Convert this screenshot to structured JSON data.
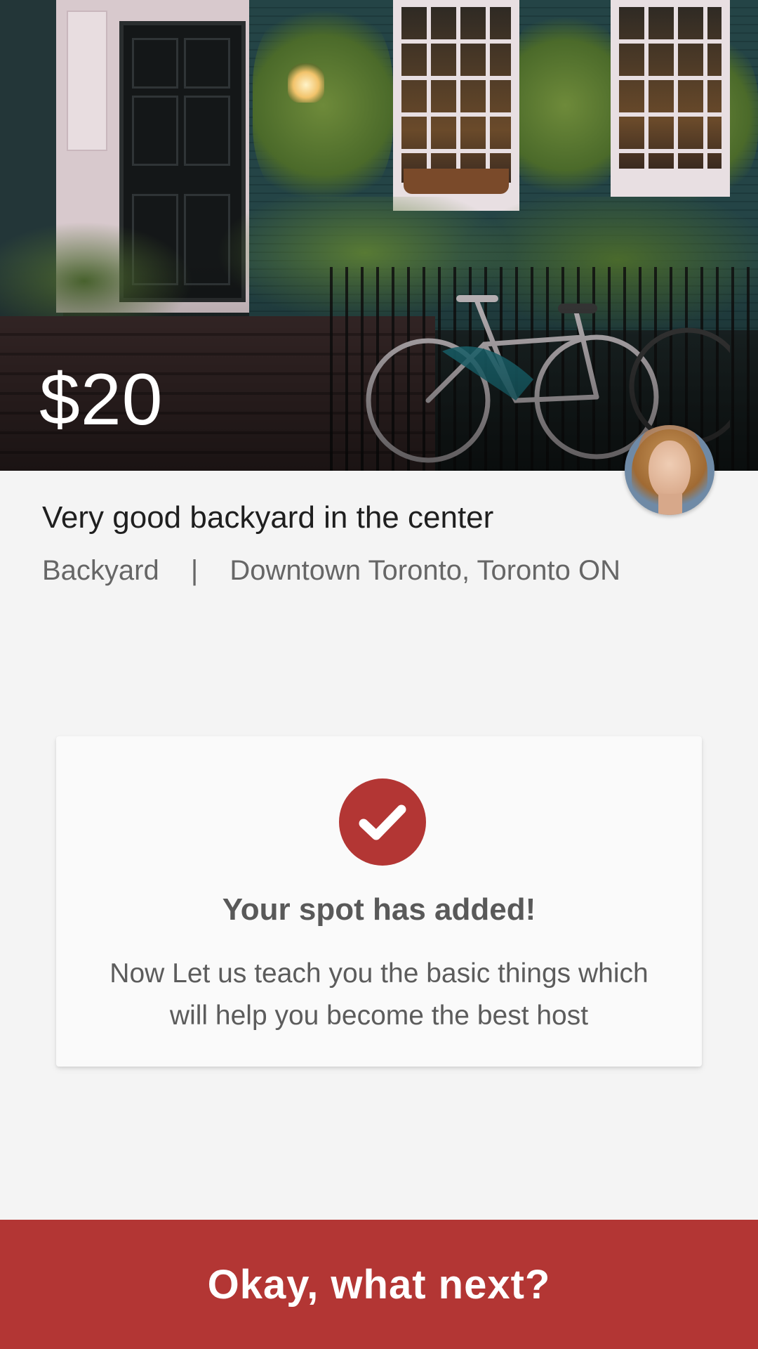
{
  "listing": {
    "price": "$20",
    "title": "Very good backyard in the center",
    "type": "Backyard",
    "separator": "|",
    "location": "Downtown Toronto, Toronto ON"
  },
  "success_card": {
    "icon": "check-circle-icon",
    "title": "Your spot has added!",
    "message": "Now Let us teach you the basic things which will help you become the best host"
  },
  "cta": {
    "label": "Okay, what next?"
  },
  "colors": {
    "accent": "#b33634",
    "background": "#f4f4f4",
    "card": "#fafafa"
  }
}
